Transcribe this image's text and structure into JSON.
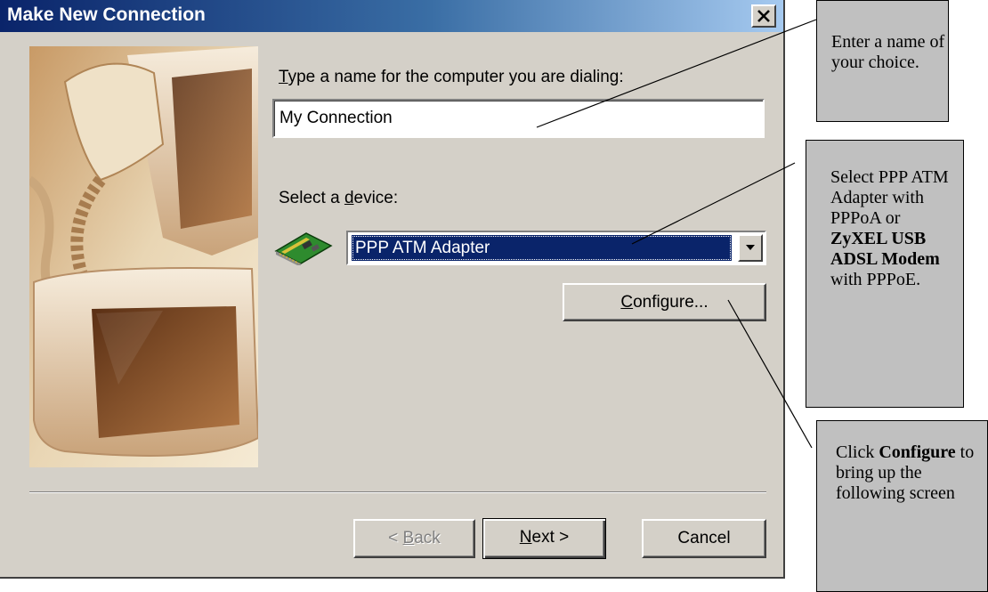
{
  "window": {
    "title": "Make New Connection",
    "close_glyph": "×"
  },
  "form": {
    "name_label_mnemonic": "T",
    "name_label_rest": "ype a name for the computer you are dialing:",
    "name_value": "My Connection",
    "device_label_pre": "Select a ",
    "device_label_mnemonic": "d",
    "device_label_post": "evice:",
    "device_icon": "modem-card-icon",
    "device_value": "PPP ATM Adapter",
    "configure_mnemonic": "C",
    "configure_rest": "onfigure..."
  },
  "footer": {
    "back_pre": "< ",
    "back_mnemonic": "B",
    "back_rest": "ack",
    "back_enabled": false,
    "next_mnemonic": "N",
    "next_rest": "ext >",
    "cancel_label": "Cancel"
  },
  "annotations": {
    "note1": "Enter a name of your choice.",
    "note2_plain1": "Select PPP ATM Adapter with PPPoA or ",
    "note2_bold1": "ZyXEL USB ADSL Modem",
    "note2_plain2": " with PPPoE.",
    "note3_plain1": "Click ",
    "note3_bold1": "Configure",
    "note3_plain2": " to bring up the following screen"
  },
  "colors": {
    "title_bar_start": "#0a246a",
    "title_bar_end": "#a6caf0",
    "dialog_face": "#d4d0c8",
    "selection": "#0a246a",
    "note_background": "#c0c0c0"
  }
}
